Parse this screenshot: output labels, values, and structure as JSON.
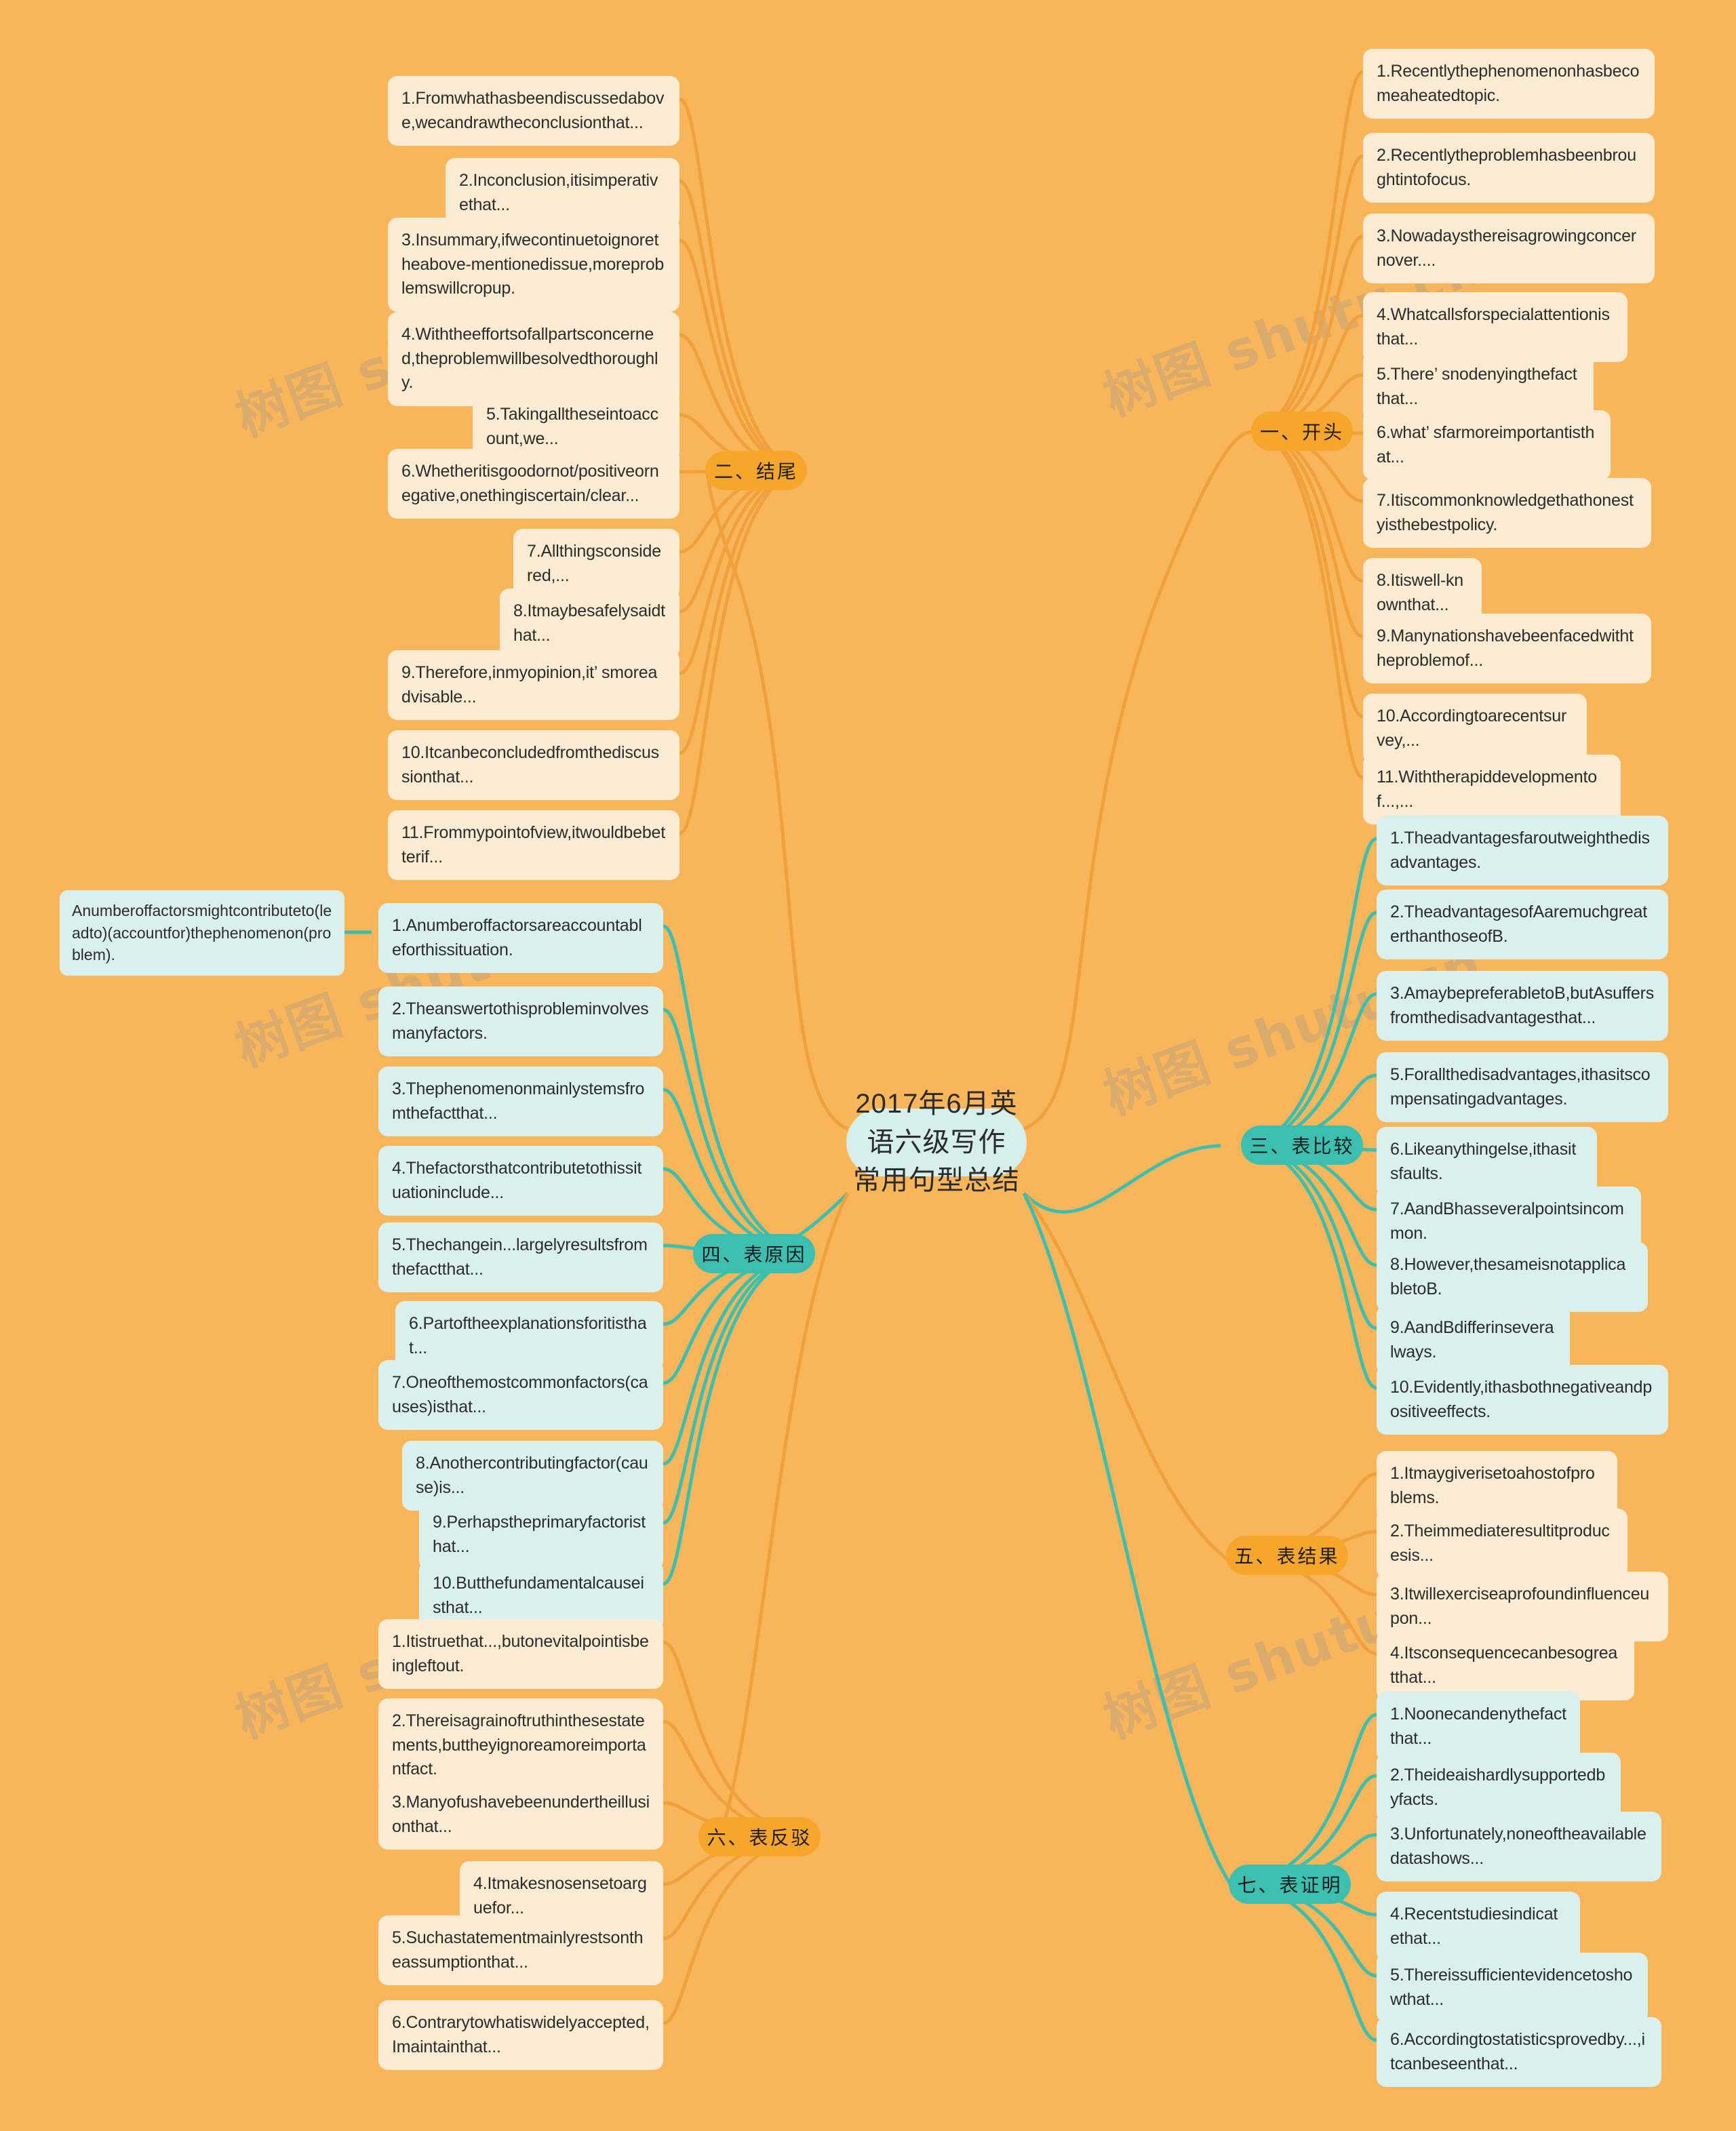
{
  "root": {
    "title": "2017年6月英语六级写作\n常用句型总结"
  },
  "branches": [
    {
      "key": "b1",
      "label": "一、开头",
      "color": "orange",
      "side": "right",
      "items": [
        "1.Recentlythephenomenonhasbecomeaheatedtopic.",
        "2.Recentlytheproblemhasbeenbroughtintofocus.",
        "3.Nowadaysthereisagrowingconcernover....",
        "4.Whatcallsforspecialattentionisthat...",
        "5.There’ snodenyingthefactthat...",
        "6.what’ sfarmoreimportantisthat...",
        "7.Itiscommonknowledgethathonestyisthebestpolicy.",
        "8.Itiswell-knownthat...",
        "9.Manynationshavebeenfacedwiththeproblemof...",
        "10.Accordingtoarecentsurvey,...",
        "11.Withtherapiddevelopmentof...,..."
      ]
    },
    {
      "key": "b2",
      "label": "二、结尾",
      "color": "orange",
      "side": "left",
      "items": [
        "1.Fromwhathasbeendiscussedabove,wecandrawtheconclusionthat...",
        "2.Inconclusion,itisimperativethat...",
        "3.Insummary,ifwecontinuetoignoretheabove-mentionedissue,moreproblemswillcropup.",
        "4.Withtheeffortsofallpartsconcerned,theproblemwillbesolvedthoroughly.",
        "5.Takingalltheseintoaccount,we...",
        "6.Whetheritisgoodornot/positiveornegative,onethingiscertain/clear...",
        "7.Allthingsconsidered,...",
        "8.Itmaybesafelysaidthat...",
        "9.Therefore,inmyopinion,it’ smoreadvisable...",
        "10.Itcanbeconcludedfromthediscussionthat...",
        "11.Frommypointofview,itwouldbebetterif..."
      ]
    },
    {
      "key": "b3",
      "label": "三、表比较",
      "color": "teal",
      "side": "right",
      "items": [
        "1.Theadvantagesfaroutweighthedisadvantages.",
        "2.TheadvantagesofAaremuchgreaterthanthoseofB.",
        "3.AmaybepreferabletoB,butAsuffersfromthedisadvantagesthat...",
        "5.Forallthedisadvantages,ithasitscompensatingadvantages.",
        "6.Likeanythingelse,ithasitsfaults.",
        "7.AandBhasseveralpointsincommon.",
        "8.However,thesameisnotapplicabletoB.",
        "9.AandBdifferinseveralways.",
        "10.Evidently,ithasbothnegativeandpositiveeffects."
      ]
    },
    {
      "key": "b4",
      "label": "四、表原因",
      "color": "teal",
      "side": "left",
      "items": [
        "1.Anumberoffactorsareaccountableforthissituation.",
        "2.Theanswertothisprobleminvolvesmanyfactors.",
        "3.Thephenomenonmainlystemsfromthefactthat...",
        "4.Thefactorsthatcontributetothissituationinclude...",
        "5.Thechangein...largelyresultsfromthefactthat...",
        "6.Partoftheexplanationsforitisthat...",
        "7.Oneofthemostcommonfactors(causes)isthat...",
        "8.Anothercontributingfactor(cause)is...",
        "9.Perhapstheprimaryfactoristhat...",
        "10.Butthefundamentalcauseisthat..."
      ]
    },
    {
      "key": "b5",
      "label": "五、表结果",
      "color": "orange",
      "side": "right",
      "items": [
        "1.Itmaygiverisetoahostofproblems.",
        "2.Theimmediateresultitproducesis...",
        "3.Itwillexerciseaprofoundinfluenceupon...",
        "4.Itsconsequencecanbesogreatthat..."
      ]
    },
    {
      "key": "b6",
      "label": "六、表反驳",
      "color": "orange",
      "side": "left",
      "items": [
        "1.Itistruethat...,butonevitalpointisbeingleftout.",
        "2.Thereisagrainoftruthinthesestatements,buttheyignoreamoreimportantfact.",
        "3.Manyofushavebeenundertheillusionthat...",
        "4.Itmakesnosensetoarguefor...",
        "5.Suchastatementmainlyrestsontheassumptionthat...",
        "6.Contrarytowhatiswidelyaccepted,Imaintainthat..."
      ]
    },
    {
      "key": "b7",
      "label": "七、表证明",
      "color": "teal",
      "side": "right",
      "items": [
        "1.Noonecandenythefactthat...",
        "2.Theideaishardlysupportedbyfacts.",
        "3.Unfortunately,noneoftheavailabledatashows...",
        "4.Recentstudiesindicatethat...",
        "5.Thereissufficientevidencetoshowthat...",
        "6.Accordingtostatisticsprovedby...,itcanbeseenthat..."
      ]
    }
  ],
  "sidenote": {
    "text": "Anumberoffactorsmightcontributeto(leadto)(accountfor)thephenomenon(problem)."
  },
  "watermarks": [
    "树图 shutu.cn",
    "树图 shutu.cn",
    "树图 shutu.cn",
    "树图 shutu.cn",
    "树图 shutu.cn",
    "树图 shutu.cn"
  ],
  "colors": {
    "background": "#F8B559",
    "cream_node": "#FBEBD3",
    "mint_node": "#D9F0EE",
    "root_fill": "#D4EFEC",
    "orange_branch": "#F5A62B",
    "teal_branch": "#3DBFAF",
    "orange_wire": "#F0A03C",
    "teal_wire": "#3DBFAF"
  }
}
